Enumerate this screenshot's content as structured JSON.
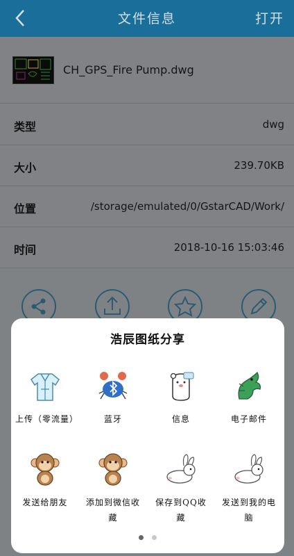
{
  "header": {
    "title": "文件信息",
    "action_label": "打开"
  },
  "file": {
    "name": "CH_GPS_Fire Pump.dwg"
  },
  "details": [
    {
      "label": "类型",
      "value": "dwg"
    },
    {
      "label": "大小",
      "value": "239.70KB"
    },
    {
      "label": "位置",
      "value": "/storage/emulated/0/GstarCAD/Work/"
    },
    {
      "label": "时间",
      "value": "2018-10-16 15:03:46"
    }
  ],
  "actions": [
    {
      "icon": "share-icon"
    },
    {
      "icon": "upload-icon"
    },
    {
      "icon": "star-icon"
    },
    {
      "icon": "pencil-icon"
    }
  ],
  "share_sheet": {
    "title": "浩辰图纸分享",
    "items": [
      {
        "label": "上传（零流量）",
        "icon": "coat-icon"
      },
      {
        "label": "蓝牙",
        "icon": "bluetooth-crab-icon"
      },
      {
        "label": "信息",
        "icon": "message-bear-icon"
      },
      {
        "label": "电子邮件",
        "icon": "email-dragon-icon"
      },
      {
        "label": "发送给朋友",
        "icon": "monkey-icon"
      },
      {
        "label": "添加到微信收藏",
        "icon": "monkey-icon"
      },
      {
        "label": "保存到QQ收藏",
        "icon": "rabbit-icon"
      },
      {
        "label": "发送到我的电脑",
        "icon": "rabbit-icon"
      }
    ],
    "page_indicator": {
      "current": 1,
      "total": 2
    }
  },
  "colors": {
    "header": "#1a6f9a",
    "overlay": "#808285",
    "sheet": "#ffffff"
  }
}
